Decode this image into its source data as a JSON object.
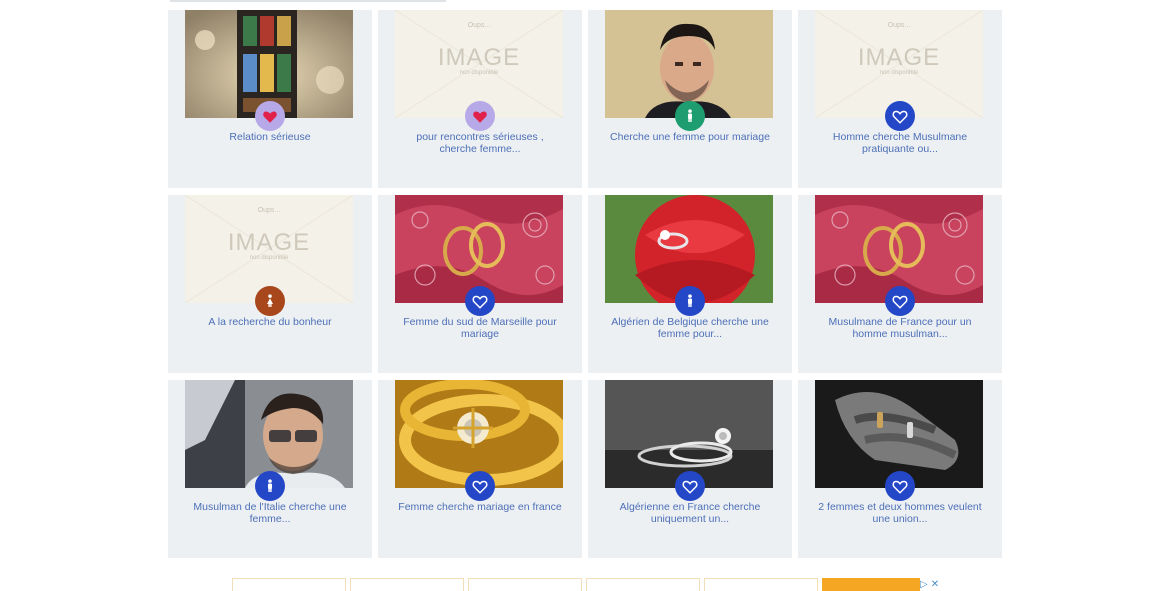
{
  "colors": {
    "card_bg": "#edf0f2",
    "caption": "#4c6fb8",
    "badge_pink_bg": "#b7a8e8",
    "badge_pink_heart": "#e0224b",
    "badge_blue": "#2447c8",
    "badge_green": "#1e9e70",
    "badge_brown": "#a8471c"
  },
  "listings": [
    {
      "caption": "Relation sérieuse",
      "image": "lantern",
      "badge": "heart-pink"
    },
    {
      "caption": "pour rencontres sérieuses , cherche femme...",
      "image": "placeholder",
      "badge": "heart-pink"
    },
    {
      "caption": "Cherche une femme pour mariage",
      "image": "man-portrait",
      "badge": "man-green"
    },
    {
      "caption": "Homme cherche Musulmane pratiquante ou...",
      "image": "placeholder",
      "badge": "heart-blue"
    },
    {
      "caption": "A la recherche du bonheur",
      "image": "placeholder",
      "badge": "woman-brown"
    },
    {
      "caption": "Femme du sud de Marseille pour mariage",
      "image": "rings-pink",
      "badge": "heart-blue"
    },
    {
      "caption": "Algérien de Belgique cherche une femme pour...",
      "image": "ring-rose",
      "badge": "man-blue"
    },
    {
      "caption": "Musulmane de France pour un homme musulman...",
      "image": "rings-pink",
      "badge": "heart-blue"
    },
    {
      "caption": "Musulman de l'Italie cherche une femme...",
      "image": "man-car",
      "badge": "man-blue"
    },
    {
      "caption": "Femme cherche mariage en france",
      "image": "gold-rings",
      "badge": "heart-blue"
    },
    {
      "caption": "Algérienne en France cherche uniquement un...",
      "image": "bw-rings",
      "badge": "heart-blue"
    },
    {
      "caption": "2 femmes et deux hommes veulent une union...",
      "image": "bw-hands",
      "badge": "heart-blue"
    }
  ],
  "placeholder": {
    "top": "Oups...",
    "main": "IMAGE",
    "sub": "non disponible"
  },
  "adchoices": {
    "play": "▷",
    "close": "✕"
  }
}
